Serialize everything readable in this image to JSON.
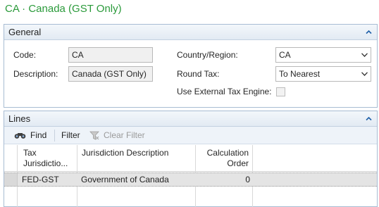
{
  "page": {
    "title": "CA · Canada (GST Only)"
  },
  "general": {
    "header": "General",
    "code_label": "Code:",
    "code_value": "CA",
    "description_label": "Description:",
    "description_value": "Canada (GST Only)",
    "country_label": "Country/Region:",
    "country_value": "CA",
    "round_tax_label": "Round Tax:",
    "round_tax_value": "To Nearest",
    "external_engine_label": "Use External Tax Engine:",
    "external_engine_checked": false
  },
  "lines": {
    "header": "Lines",
    "toolbar": {
      "find": "Find",
      "filter": "Filter",
      "clear_filter": "Clear Filter"
    },
    "columns": {
      "tax_jurisdiction_1": "Tax",
      "tax_jurisdiction_2": "Jurisdictio...",
      "jurisdiction_description": "Jurisdiction Description",
      "calculation_1": "Calculation",
      "calculation_2": "Order"
    },
    "rows": [
      {
        "tax_jurisdiction": "FED-GST",
        "jurisdiction_description": "Government of Canada",
        "calculation_order": "0"
      }
    ]
  },
  "colors": {
    "title_green": "#2a9a3a",
    "panel_border": "#a8bcd3",
    "header_bg": "#e2eaf3",
    "selected_row": "#e4e4e4"
  },
  "icons": [
    "collapse-up-icon",
    "binoculars-icon",
    "filter-icon",
    "chevron-down-icon"
  ]
}
